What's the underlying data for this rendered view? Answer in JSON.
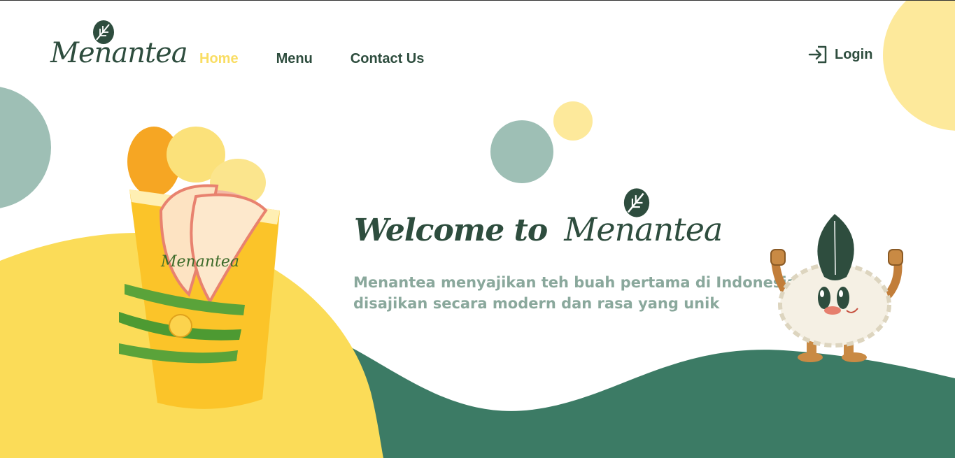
{
  "brand": {
    "name": "Menantea",
    "colors": {
      "dark_green": "#2e4d3e",
      "accent_yellow": "#f9dd63",
      "muted_green": "#8aa89c",
      "wave_green": "#3c7b65",
      "circle_teal": "#9ebfb5",
      "pale_yellow": "#fde99b"
    }
  },
  "nav": {
    "items": [
      {
        "label": "Home",
        "active": true
      },
      {
        "label": "Menu",
        "active": false
      },
      {
        "label": "Contact Us",
        "active": false
      }
    ],
    "login_label": "Login",
    "login_icon": "login-arrow-icon"
  },
  "hero": {
    "title_prefix": "Welcome to",
    "title_brand": "Menantea",
    "subtitle_line1": "Menantea menyajikan teh buah pertama di Indonesia",
    "subtitle_line2": "disajikan secara modern dan rasa yang unik"
  },
  "drink": {
    "cup_brand": "Menantea"
  }
}
